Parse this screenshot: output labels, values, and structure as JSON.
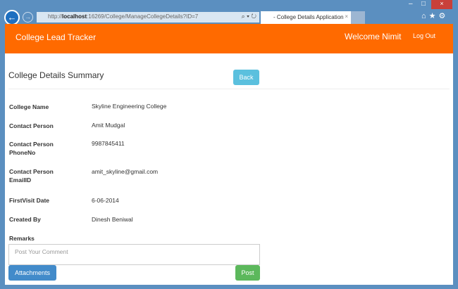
{
  "browser": {
    "url_prefix": "http://",
    "url_host": "localhost",
    "url_rest": ":16269/College/ManageCollegeDetails?ID=7",
    "tab_title": "- College Details Application"
  },
  "nav": {
    "brand": "College Lead Tracker",
    "welcome": "Welcome Nimit",
    "logout": "Log Out"
  },
  "page": {
    "title": "College Details Summary",
    "back": "Back"
  },
  "fields": [
    {
      "label": "College Name",
      "value": "Skyline Engineering College"
    },
    {
      "label": "Contact Person",
      "value": "Amit Mudgal"
    },
    {
      "label": "Contact Person PhoneNo",
      "value": "9987845411"
    },
    {
      "label": "Contact Person EmailID",
      "value": "amit_skyline@gmail.com"
    },
    {
      "label": "FirstVisit Date",
      "value": "6-06-2014"
    },
    {
      "label": "Created By",
      "value": "Dinesh Beniwal"
    }
  ],
  "remarks": {
    "label": "Remarks",
    "placeholder": "Post Your Comment",
    "attachments": "Attachments",
    "post": "Post"
  }
}
